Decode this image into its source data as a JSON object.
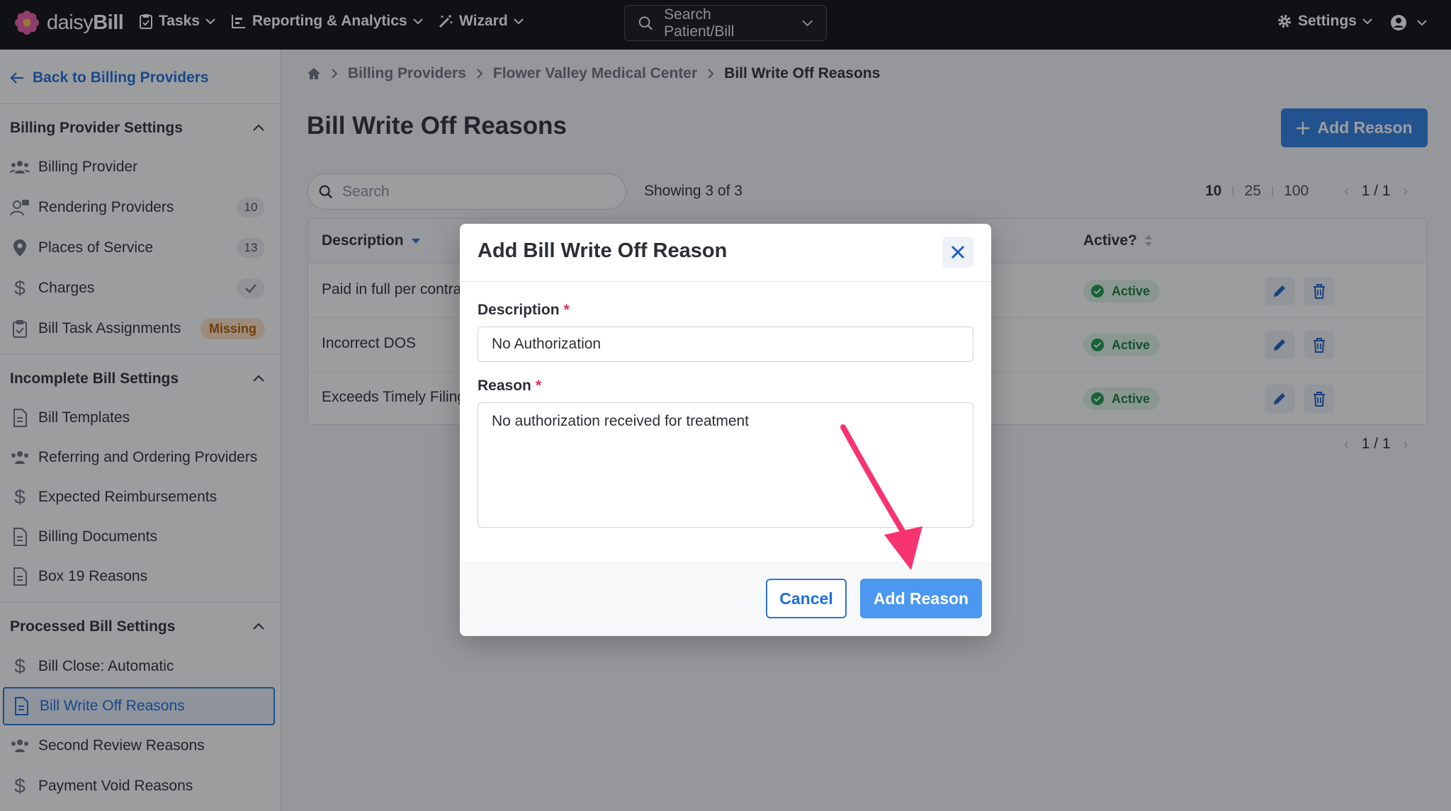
{
  "app": {
    "brand_main": "daisy",
    "brand_bold": "Bill"
  },
  "topnav": {
    "tasks": "Tasks",
    "reporting": "Reporting & Analytics",
    "wizard": "Wizard",
    "search_placeholder": "Search Patient/Bill",
    "settings": "Settings"
  },
  "sidebar": {
    "back": "Back to Billing Providers",
    "sections": [
      {
        "title": "Billing Provider Settings",
        "items": [
          {
            "label": "Billing Provider",
            "icon": "users-icon"
          },
          {
            "label": "Rendering Providers",
            "icon": "user-chat-icon",
            "badge": "10"
          },
          {
            "label": "Places of Service",
            "icon": "map-pin-icon",
            "badge": "13"
          },
          {
            "label": "Charges",
            "icon": "dollar-icon",
            "badge": "check"
          },
          {
            "label": "Bill Task Assignments",
            "icon": "clipboard-check-icon",
            "badge": "Missing"
          }
        ]
      },
      {
        "title": "Incomplete Bill Settings",
        "items": [
          {
            "label": "Bill Templates",
            "icon": "document-icon"
          },
          {
            "label": "Referring and Ordering Providers",
            "icon": "users-icon"
          },
          {
            "label": "Expected Reimbursements",
            "icon": "dollar-icon"
          },
          {
            "label": "Billing Documents",
            "icon": "document-icon"
          },
          {
            "label": "Box 19 Reasons",
            "icon": "document-icon"
          }
        ]
      },
      {
        "title": "Processed Bill Settings",
        "items": [
          {
            "label": "Bill Close: Automatic",
            "icon": "dollar-icon"
          },
          {
            "label": "Bill Write Off Reasons",
            "icon": "document-icon",
            "active": true
          },
          {
            "label": "Second Review Reasons",
            "icon": "users-icon"
          },
          {
            "label": "Payment Void Reasons",
            "icon": "dollar-icon"
          }
        ]
      }
    ]
  },
  "breadcrumb": [
    "Billing Providers",
    "Flower Valley Medical Center",
    "Bill Write Off Reasons"
  ],
  "page": {
    "title": "Bill Write Off Reasons",
    "add_button": "Add Reason",
    "search_placeholder": "Search",
    "showing": "Showing 3 of 3",
    "page_sizes": [
      "10",
      "25",
      "100"
    ],
    "pager": "1 / 1"
  },
  "table": {
    "columns": {
      "description": "Description",
      "active": "Active?"
    },
    "rows": [
      {
        "description": "Paid in full per contract",
        "status": "Active"
      },
      {
        "description": "Incorrect DOS",
        "status": "Active"
      },
      {
        "description": "Exceeds Timely Filing",
        "status": "Active"
      }
    ]
  },
  "modal": {
    "title": "Add Bill Write Off Reason",
    "description_label": "Description",
    "description_value": "No Authorization",
    "reason_label": "Reason",
    "reason_value": "No authorization received for treatment",
    "required_mark": "*",
    "cancel": "Cancel",
    "submit": "Add Reason"
  },
  "colors": {
    "accent": "#2f80e4",
    "annotation": "#f7346f",
    "active": "#1a7a3f"
  }
}
